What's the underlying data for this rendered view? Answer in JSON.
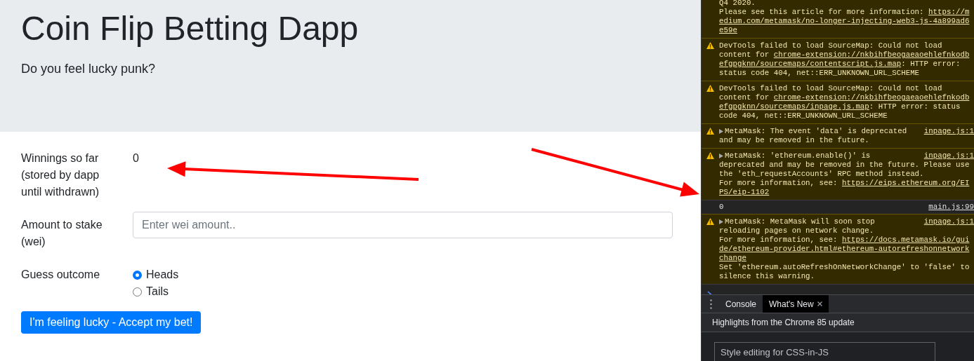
{
  "page": {
    "title": "Coin Flip Betting Dapp",
    "subtitle": "Do you feel lucky punk?"
  },
  "form": {
    "winnings_label": "Winnings so far (stored by dapp until withdrawn)",
    "winnings_value": "0",
    "stake_label": "Amount to stake (wei)",
    "stake_placeholder": "Enter wei amount..",
    "guess_label": "Guess outcome",
    "options": [
      {
        "label": "Heads",
        "selected": true
      },
      {
        "label": "Tails",
        "selected": false
      }
    ],
    "submit": "I'm feeling lucky - Accept my bet!"
  },
  "devtools": {
    "messages": [
      {
        "kind": "warning",
        "icon": false,
        "expandable": false,
        "lines": [
          [
            {
              "text": "Q4 2020."
            }
          ],
          [
            {
              "text": "Please see this article for more information: "
            },
            {
              "link": "https://m"
            }
          ],
          [
            {
              "link": "edium.com/metamask/no-longer-injecting-web3-js-4a899ad6"
            }
          ],
          [
            {
              "link": "e59e"
            }
          ]
        ]
      },
      {
        "kind": "warning",
        "icon": true,
        "expandable": false,
        "lines": [
          [
            {
              "text": "DevTools failed to load SourceMap: Could not load"
            }
          ],
          [
            {
              "text": "content for "
            },
            {
              "link": "chrome-extension://nkbihfbeogaeaoehlefnkodb"
            }
          ],
          [
            {
              "link": "efgpgknn/sourcemaps/contentscript.js.map"
            },
            {
              "text": ": HTTP error:"
            }
          ],
          [
            {
              "text": "status code 404, net::ERR_UNKNOWN_URL_SCHEME"
            }
          ]
        ]
      },
      {
        "kind": "warning",
        "icon": true,
        "expandable": false,
        "lines": [
          [
            {
              "text": "DevTools failed to load SourceMap: Could not load"
            }
          ],
          [
            {
              "text": "content for "
            },
            {
              "link": "chrome-extension://nkbihfbeogaeaoehlefnkodb"
            }
          ],
          [
            {
              "link": "efgpgknn/sourcemaps/inpage.js.map"
            },
            {
              "text": ": HTTP error: status"
            }
          ],
          [
            {
              "text": "code 404, net::ERR_UNKNOWN_URL_SCHEME"
            }
          ]
        ]
      },
      {
        "kind": "warning",
        "icon": true,
        "expandable": true,
        "source": "inpage.js:1",
        "lines": [
          [
            {
              "text": "MetaMask: The event 'data' is deprecated"
            }
          ],
          [
            {
              "text": "and may be removed in the future."
            }
          ]
        ]
      },
      {
        "kind": "warning",
        "icon": true,
        "expandable": true,
        "source": "inpage.js:1",
        "lines": [
          [
            {
              "text": "MetaMask: 'ethereum.enable()' is"
            }
          ],
          [
            {
              "text": "deprecated and may be removed in the future. Please use"
            }
          ],
          [
            {
              "text": "the 'eth_requestAccounts' RPC method instead."
            }
          ],
          [
            {
              "text": "For more information, see: "
            },
            {
              "link": "https://eips.ethereum.org/EI"
            }
          ],
          [
            {
              "link": "PS/eip-1102"
            }
          ]
        ]
      },
      {
        "kind": "log",
        "icon": false,
        "expandable": false,
        "source": "main.js:99",
        "lines": [
          [
            {
              "text": "0"
            }
          ]
        ]
      },
      {
        "kind": "warning",
        "icon": true,
        "expandable": true,
        "source": "inpage.js:1",
        "lines": [
          [
            {
              "text": "MetaMask: MetaMask will soon stop"
            }
          ],
          [
            {
              "text": "reloading pages on network change."
            }
          ],
          [
            {
              "text": "For more information, see: "
            },
            {
              "link": "https://docs.metamask.io/gui"
            }
          ],
          [
            {
              "link": "de/ethereum-provider.html#ethereum-autorefreshonnetwork"
            }
          ],
          [
            {
              "link": "change"
            }
          ],
          [
            {
              "text": "Set 'ethereum.autoRefreshOnNetworkChange' to 'false' to"
            }
          ],
          [
            {
              "text": "silence this warning."
            }
          ]
        ]
      }
    ],
    "drawer_tabs": [
      {
        "label": "Console",
        "selected": false,
        "closable": false
      },
      {
        "label": "What's New",
        "selected": true,
        "closable": true
      }
    ],
    "whats_new_title": "Highlights from the Chrome 85 update",
    "card_title": "Style editing for CSS-in-JS"
  }
}
